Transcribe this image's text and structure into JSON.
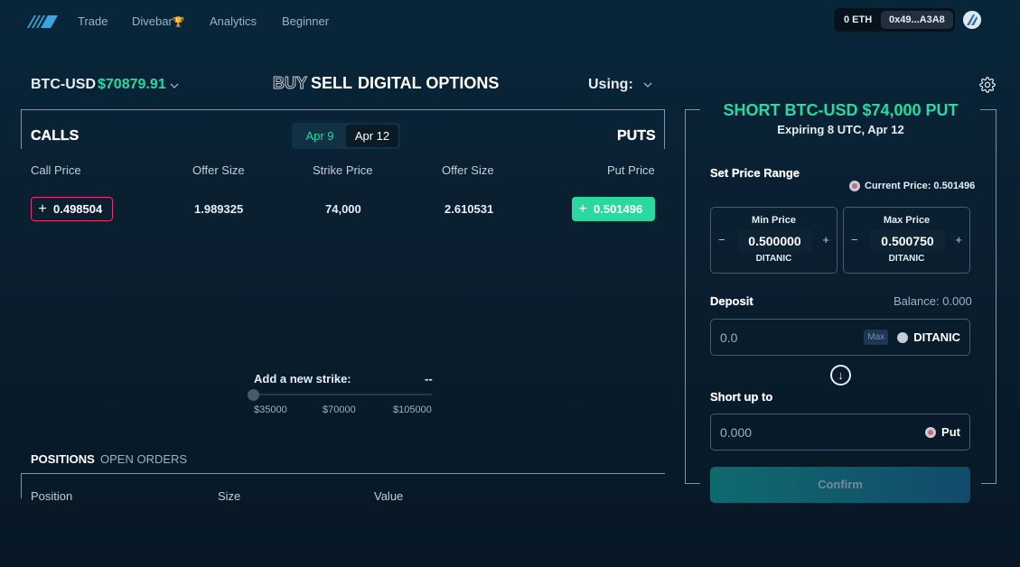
{
  "nav": {
    "links": [
      "Trade",
      "Divebar",
      "Analytics",
      "Beginner"
    ],
    "eth_balance": "0 ETH",
    "address": "0x49...A3A8"
  },
  "header": {
    "pair": "BTC-USD",
    "price": "$70879.91",
    "modes": [
      "BUY",
      "SELL",
      "DIGITAL OPTIONS"
    ],
    "active_mode": "SELL",
    "using_label": "Using:"
  },
  "table": {
    "calls_label": "CALLS",
    "puts_label": "PUTS",
    "dates": [
      "Apr 9",
      "Apr 12"
    ],
    "selected_date": "Apr 12",
    "columns": [
      "Call Price",
      "Offer Size",
      "Strike Price",
      "Offer Size",
      "Put Price"
    ],
    "rows": [
      {
        "call_price": "0.498504",
        "call_size": "1.989325",
        "strike": "74,000",
        "put_size": "2.610531",
        "put_price": "0.501496"
      }
    ]
  },
  "add_strike": {
    "label": "Add a new strike:",
    "value": "--",
    "ticks": [
      "$35000",
      "$70000",
      "$105000"
    ]
  },
  "positions": {
    "tabs": [
      "POSITIONS",
      "OPEN ORDERS"
    ],
    "columns": [
      "Position",
      "Size",
      "Value"
    ]
  },
  "panel": {
    "title": "SHORT BTC-USD $74,000 PUT",
    "subtitle": "Expiring 8 UTC, Apr 12",
    "price_range_label": "Set Price Range",
    "current_price": "Current Price: 0.501496",
    "min": {
      "label": "Min Price",
      "value": "0.500000",
      "unit": "DITANIC"
    },
    "max": {
      "label": "Max Price",
      "value": "0.500750",
      "unit": "DITANIC"
    },
    "deposit_label": "Deposit",
    "balance": "Balance: 0.000",
    "deposit_value": "0.0",
    "max_label": "Max",
    "deposit_token": "DITANIC",
    "short_label": "Short up to",
    "short_value": "0.000",
    "short_token": "Put",
    "confirm_label": "Confirm"
  },
  "colors": {
    "accent_green": "#2bd9a0",
    "call_red": "#e6336e",
    "background": "#0a1f30"
  },
  "icons": [
    "logo-icon",
    "trophy-icon",
    "chevron-down-icon",
    "gear-icon",
    "plus-icon",
    "arrow-down-icon",
    "coin-icon"
  ]
}
